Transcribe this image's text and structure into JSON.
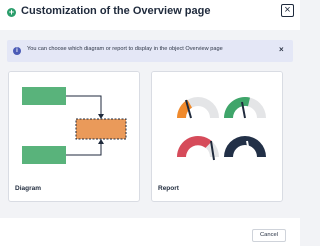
{
  "dialog": {
    "title": "Customization of the Overview page",
    "close_icon": "close-icon"
  },
  "info": {
    "text": "You can choose which diagram or report to display in the object Overview page",
    "icon": "info-icon",
    "close_icon": "close-icon"
  },
  "cards": {
    "diagram": {
      "label": "Diagram"
    },
    "report": {
      "label": "Report"
    }
  },
  "footer": {
    "cancel_label": "Cancel"
  },
  "colors": {
    "accent_green": "#2a9d6b",
    "diagram_green": "#59b37b",
    "diagram_orange": "#ea9a5a",
    "gauge_red": "#d64b5a",
    "gauge_dark": "#223047",
    "info_blue": "#4b5bb6"
  }
}
